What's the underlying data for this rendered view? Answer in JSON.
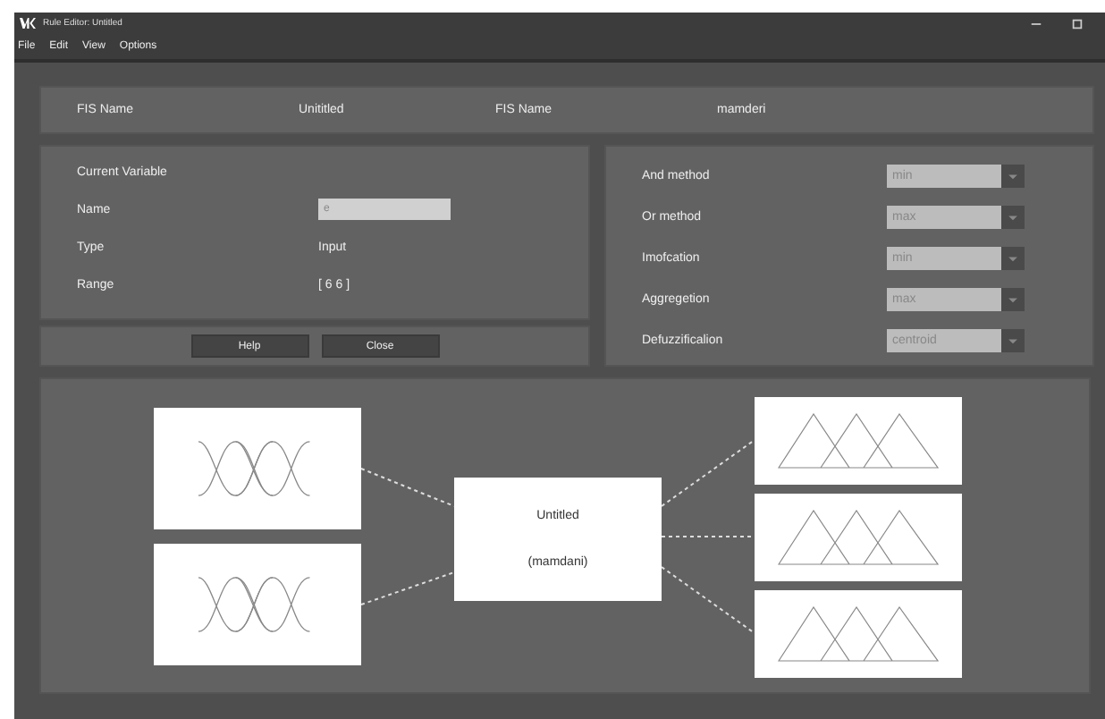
{
  "window": {
    "title": "Rule Editor: Untitled"
  },
  "menu": [
    "File",
    "Edit",
    "View",
    "Options"
  ],
  "fis_bar": [
    {
      "label": "FIS Name",
      "value": "Unititled"
    },
    {
      "label": "FIS Name",
      "value": "mamderi"
    }
  ],
  "current_variable": {
    "heading": "Current Variable",
    "fields": [
      {
        "label": "Name",
        "value": "e",
        "kind": "input"
      },
      {
        "label": "Type",
        "value": "Input",
        "kind": "text"
      },
      {
        "label": "Range",
        "value": "[ 6 6 ]",
        "kind": "text"
      }
    ]
  },
  "buttons": [
    "Help",
    "Close"
  ],
  "methods": [
    {
      "label": "And method",
      "value": "min"
    },
    {
      "label": "Or method",
      "value": "max"
    },
    {
      "label": "Imofcation",
      "value": "min"
    },
    {
      "label": "Aggregetion",
      "value": "max"
    },
    {
      "label": "Defuzzificalion",
      "value": "centroid"
    }
  ],
  "diagram": {
    "inputs": [
      {
        "kind": "gaussian"
      },
      {
        "kind": "gaussian"
      }
    ],
    "system": {
      "name": "Untitled",
      "type": "(mamdani)"
    },
    "outputs": [
      {
        "kind": "triangle"
      },
      {
        "kind": "triangle"
      },
      {
        "kind": "triangle"
      }
    ]
  }
}
